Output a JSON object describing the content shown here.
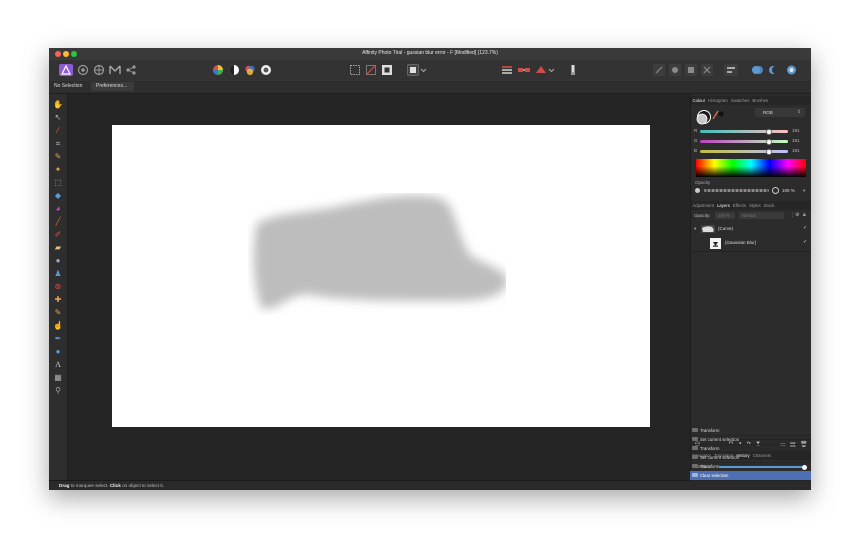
{
  "window": {
    "title": "Affinity Photo Trial - gussian blur error - F [Modified] (123.7%)"
  },
  "context_toolbar": {
    "selection_label": "No Selection",
    "preferences_label": "Preferences..."
  },
  "status_bar": {
    "drag_word": "Drag",
    "drag_text": " to marquee select. ",
    "click_word": "Click",
    "click_text": " on object to select it."
  },
  "colour_panel": {
    "tabs": [
      "Colour",
      "Histogram",
      "Swatches",
      "Brushes"
    ],
    "mode": "RGB",
    "channels": [
      {
        "label": "R",
        "value": "191"
      },
      {
        "label": "G",
        "value": "191"
      },
      {
        "label": "B",
        "value": "191"
      }
    ],
    "opacity_label": "Opacity",
    "opacity_value": "100 %"
  },
  "layers_panel": {
    "tabs": [
      "Adjustment",
      "Layers",
      "Effects",
      "Styles",
      "Stock"
    ],
    "opacity_label": "Opacity:",
    "opacity_value": "100 %",
    "blend_mode": "Normal",
    "layers": [
      {
        "name": "(Curve)"
      },
      {
        "name": "(Gaussian Blur)"
      }
    ]
  },
  "history_panel": {
    "tabs": [
      "Navigator",
      "Transform",
      "History",
      "Channels"
    ],
    "position_label": "Position:",
    "items": [
      {
        "label": "Transform"
      },
      {
        "label": "Set current selection"
      },
      {
        "label": "Transform"
      },
      {
        "label": "Set current selection"
      },
      {
        "label": "Transform"
      },
      {
        "label": "Clear selection"
      }
    ]
  },
  "colors": {
    "accent": "#5b9bd5",
    "history_selected": "#4e6fb3",
    "blur_shape": "#bdbdbd",
    "close": "#ff5f57",
    "minimize": "#febc2e",
    "zoom": "#28c840"
  },
  "icons": {
    "tools": [
      "hand-icon",
      "move-icon",
      "color-picker-icon",
      "crop-icon",
      "selection-brush-icon",
      "flood-select-icon",
      "marquee-icon",
      "flood-fill-icon",
      "gradient-icon",
      "paint-brush-icon",
      "pixel-tool-icon",
      "erase-brush-icon",
      "dodge-icon",
      "clone-icon",
      "red-eye-icon",
      "healing-icon",
      "inpainting-icon",
      "smudge-icon",
      "pen-icon",
      "shape-icon",
      "text-icon",
      "mesh-warp-icon",
      "zoom-icon"
    ]
  }
}
